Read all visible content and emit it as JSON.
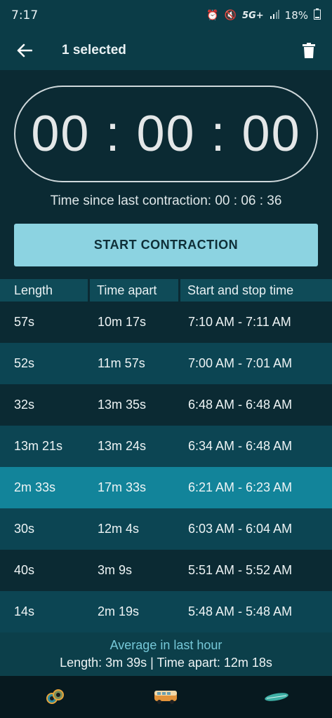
{
  "status_bar": {
    "time": "7:17",
    "network": "5G+",
    "battery": "18%",
    "icons": [
      "alarm-icon",
      "mute-icon",
      "signal-icon",
      "battery-icon"
    ]
  },
  "app_bar": {
    "title": "1 selected",
    "icons": [
      "back-arrow-icon",
      "trash-icon"
    ]
  },
  "timer": {
    "display": "00 : 00 : 00"
  },
  "since_last": {
    "label": "Time since last contraction:",
    "value": "00 : 06 : 36"
  },
  "start_button": {
    "label": "START CONTRACTION",
    "color": "#8cd3e1"
  },
  "table": {
    "headers": [
      "Length",
      "Time apart",
      "Start and stop time"
    ],
    "rows": [
      {
        "length": "57s",
        "apart": "10m 17s",
        "times": "7:10 AM - 7:11 AM"
      },
      {
        "length": "52s",
        "apart": "11m 57s",
        "times": "7:00 AM - 7:01 AM"
      },
      {
        "length": "32s",
        "apart": "13m 35s",
        "times": "6:48 AM - 6:48 AM"
      },
      {
        "length": "13m 21s",
        "apart": "13m 24s",
        "times": "6:34 AM - 6:48 AM"
      },
      {
        "length": "2m 33s",
        "apart": "17m 33s",
        "times": "6:21 AM - 6:23 AM",
        "selected": true
      },
      {
        "length": "30s",
        "apart": "12m 4s",
        "times": "6:03 AM - 6:04 AM"
      },
      {
        "length": "40s",
        "apart": "3m 9s",
        "times": "5:51 AM - 5:52 AM"
      },
      {
        "length": "14s",
        "apart": "2m 19s",
        "times": "5:48 AM - 5:48 AM"
      }
    ]
  },
  "average": {
    "heading": "Average in last hour",
    "summary": "Length: 3m 39s | Time apart: 12m 18s"
  },
  "bottom_nav": {
    "items": [
      "eyes-icon",
      "van-icon",
      "surfboard-icon"
    ]
  },
  "colors": {
    "background": "#0b2a33",
    "header": "#0b3c47",
    "row_alt": "#0c4553",
    "row_selected": "#12849a",
    "accent_text": "#76c8d8"
  }
}
